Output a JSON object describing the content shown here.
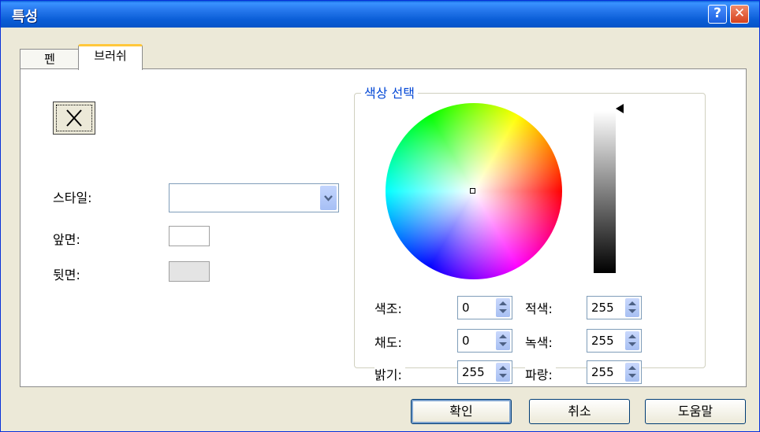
{
  "window": {
    "title": "특성",
    "help_glyph": "?",
    "close_glyph": "✕"
  },
  "tabs": [
    {
      "label": "펜",
      "selected": false
    },
    {
      "label": "브러쉬",
      "selected": true
    }
  ],
  "brush": {
    "none_glyph": "✕",
    "style_label": "스타일:",
    "style_value": "",
    "front_label": "앞면:",
    "front_color": "#ffffff",
    "back_label": "뒷면:",
    "back_color": "#e4e4e4"
  },
  "color_select": {
    "title": "색상 선택",
    "fields": {
      "hue": {
        "label": "색조:",
        "value": "0"
      },
      "saturation": {
        "label": "채도:",
        "value": "0"
      },
      "brightness": {
        "label": "밝기:",
        "value": "255"
      },
      "red": {
        "label": "적색:",
        "value": "255"
      },
      "green": {
        "label": "녹색:",
        "value": "255"
      },
      "blue": {
        "label": "파랑:",
        "value": "255"
      }
    }
  },
  "buttons": {
    "ok": "확인",
    "cancel": "취소",
    "help": "도움말"
  }
}
